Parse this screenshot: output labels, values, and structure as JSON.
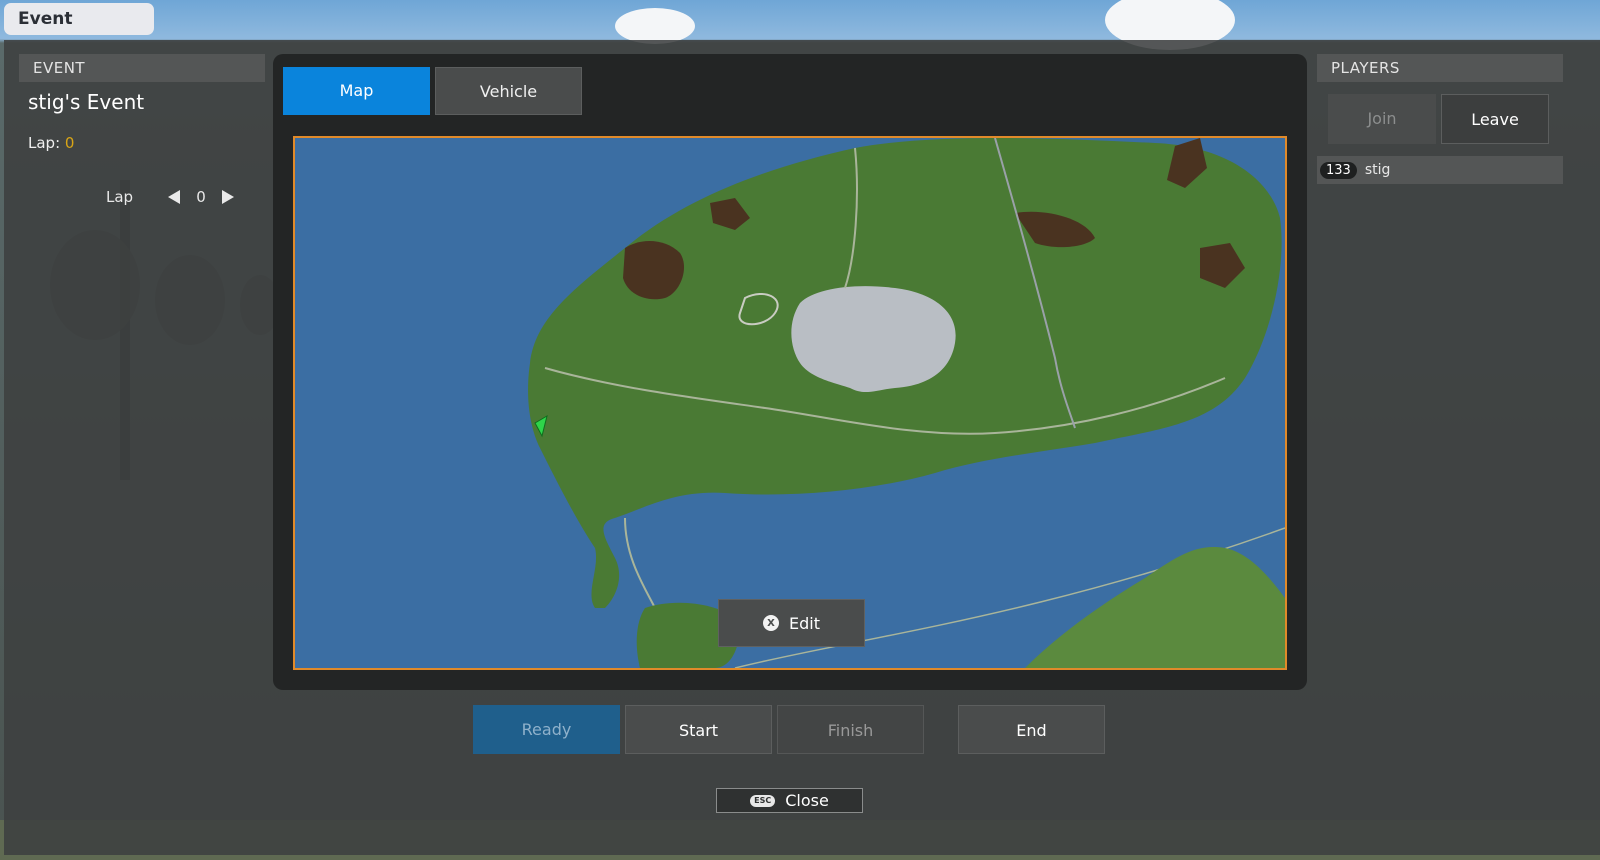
{
  "window_title": "Event",
  "event_panel": {
    "header": "EVENT",
    "event_name": "stig's Event",
    "lap_label": "Lap:",
    "lap_value": "0",
    "lap_control": {
      "label": "Lap",
      "value": "0",
      "decrement_icon": "triangle-left-icon",
      "increment_icon": "triangle-right-icon"
    }
  },
  "tabs": [
    {
      "label": "Map",
      "active": true
    },
    {
      "label": "Vehicle",
      "active": false
    }
  ],
  "map": {
    "edit_label": "Edit",
    "edit_icon": "x-button-icon",
    "marker_icon": "green-arrow-marker-icon",
    "colors": {
      "water": "#3b6ea3",
      "land": "#4a7a34",
      "lake": "#b9bec4",
      "farmland": "#4a3320",
      "border": "#e08a2a"
    }
  },
  "players_panel": {
    "header": "PLAYERS",
    "join_label": "Join",
    "leave_label": "Leave",
    "players": [
      {
        "id": "133",
        "name": "stig"
      }
    ]
  },
  "actions": {
    "ready_label": "Ready",
    "start_label": "Start",
    "finish_label": "Finish",
    "end_label": "End",
    "close_label": "Close",
    "close_key": "ESC"
  },
  "colors": {
    "accent": "#0a84dc",
    "ready": "#1f5f8c",
    "lap_value": "#d9a516"
  }
}
